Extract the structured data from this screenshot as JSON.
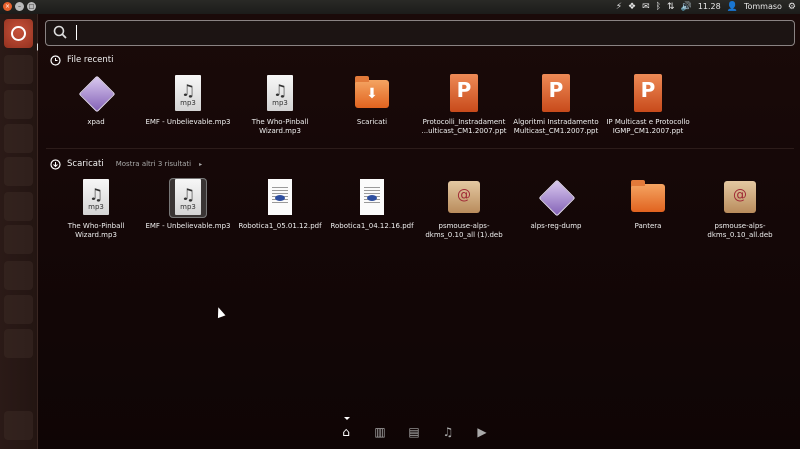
{
  "topbar": {
    "window_buttons": [
      "close-icon",
      "minimize-icon",
      "maximize-icon"
    ],
    "indicators": {
      "icons": [
        "thunderbolt-icon",
        "dropbox-icon",
        "mail-icon",
        "bluetooth-icon",
        "network-icon",
        "volume-icon"
      ],
      "time": "11.28",
      "user": "Tommaso",
      "settings_icon": "gear-icon"
    }
  },
  "launcher": {
    "items": [
      "dash-home",
      "files",
      "chromium",
      "app",
      "vlc",
      "terminal-like",
      "settings",
      "terminal",
      "screen",
      "drive",
      "trash"
    ]
  },
  "search": {
    "placeholder": "",
    "value": ""
  },
  "sections": {
    "recent": {
      "title": "File recenti",
      "items": [
        {
          "label": "xpad",
          "icon": "app-diamond"
        },
        {
          "label": "EMF - Unbelievable.mp3",
          "icon": "mp3"
        },
        {
          "label": "The Who-Pinball Wizard.mp3",
          "icon": "mp3"
        },
        {
          "label": "Scaricati",
          "icon": "downloads-folder"
        },
        {
          "label": "Protocolli_Instradament ...ulticast_CM1.2007.ppt",
          "icon": "ppt"
        },
        {
          "label": "Algoritmi Instradamento Multicast_CM1.2007.ppt",
          "icon": "ppt"
        },
        {
          "label": "IP Multicast e Protocollo IGMP_CM1.2007.ppt",
          "icon": "ppt"
        }
      ]
    },
    "downloads": {
      "title": "Scaricati",
      "more": "Mostra altri 3 risultati",
      "items": [
        {
          "label": "The Who-Pinball Wizard.mp3",
          "icon": "mp3"
        },
        {
          "label": "EMF - Unbelievable.mp3",
          "icon": "mp3"
        },
        {
          "label": "Robotica1_05.01.12.pdf",
          "icon": "pdf"
        },
        {
          "label": "Robotica1_04.12.16.pdf",
          "icon": "pdf"
        },
        {
          "label": "psmouse-alps-dkms_0.10_all (1).deb",
          "icon": "deb"
        },
        {
          "label": "alps-reg-dump",
          "icon": "app-diamond"
        },
        {
          "label": "Pantera",
          "icon": "folder"
        },
        {
          "label": "psmouse-alps-dkms_0.10_all.deb",
          "icon": "deb"
        }
      ]
    }
  },
  "lenses": [
    "home-icon",
    "applications-icon",
    "files-icon",
    "music-icon",
    "video-icon"
  ],
  "colors": {
    "accent": "#dd4814",
    "background": "#140707"
  }
}
